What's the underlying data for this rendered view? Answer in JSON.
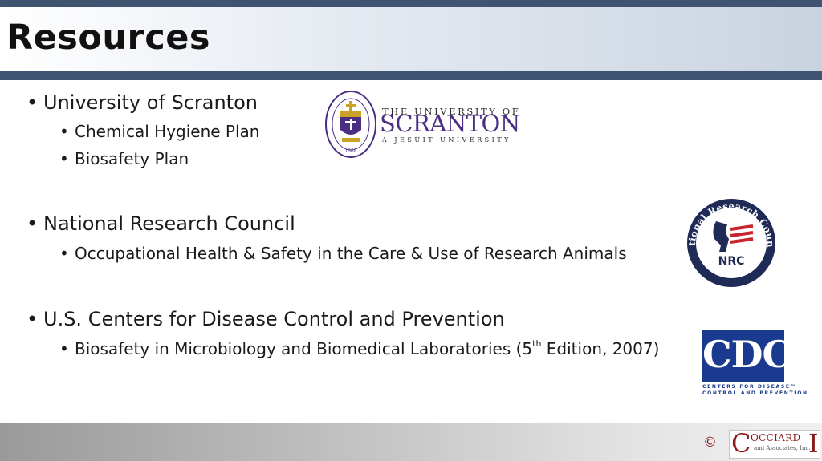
{
  "slide": {
    "title": "Resources"
  },
  "sections": [
    {
      "heading": "University of Scranton",
      "items": [
        "Chemical Hygiene Plan",
        "Biosafety Plan"
      ]
    },
    {
      "heading": "National Research Council",
      "items": [
        "Occupational Health & Safety in the Care & Use of Research Animals"
      ]
    },
    {
      "heading": "U.S. Centers for Disease Control and Prevention",
      "items": [
        {
          "before": "Biosafety in Microbiology and Biomedical Laboratories (5",
          "sup": "th",
          "after": " Edition, 2007)"
        }
      ]
    }
  ],
  "logos": {
    "scranton": {
      "line1": "THE UNIVERSITY OF",
      "line2": "SCRANTON",
      "line3": "A JESUIT UNIVERSITY",
      "seal_ring": "UNIVERSITY OF SCRANTON PENNSYLVANIA",
      "seal_year": "1888",
      "color": "#4b2e83"
    },
    "nrc": {
      "ring_text": "National Research Council",
      "abbr": "NRC",
      "color": "#1f2a57"
    },
    "cdc": {
      "abbr": "CDC",
      "sub1": "CENTERS FOR DISEASE™",
      "sub2": "CONTROL AND PREVENTION",
      "color": "#1a3a8f"
    }
  },
  "footer": {
    "copyright_symbol": "©",
    "company_c": "C",
    "company_name": "OCCIARD",
    "company_i": "I",
    "company_sub": "and Associates, Inc.",
    "brand_color": "#8b1a1a"
  }
}
